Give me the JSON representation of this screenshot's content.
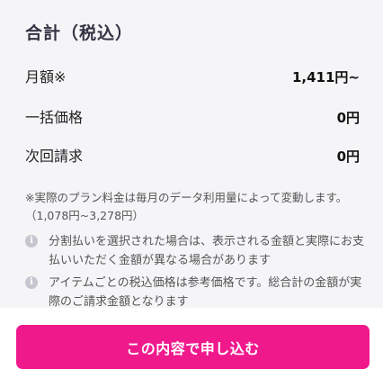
{
  "summary": {
    "title": "合計（税込）",
    "rows": [
      {
        "label": "月額※",
        "value": "1,411円~"
      },
      {
        "label": "一括価格",
        "value": "0円"
      },
      {
        "label": "次回請求",
        "value": "0円"
      }
    ]
  },
  "note": "※実際のプラン料金は毎月のデータ利用量によって変動します。（1,078円~3,278円）",
  "info_items": [
    {
      "icon": "info-icon",
      "text": "分割払いを選択された場合は、表示される金額と実際にお支払いいただく金額が異なる場合があります"
    },
    {
      "icon": "info-icon",
      "text": "アイテムごとの税込価格は参考価格です。総合計の金額が実際のご請求金額となります"
    }
  ],
  "cta": {
    "label": "この内容で申し込む"
  },
  "colors": {
    "accent": "#f0198c",
    "background": "#f5f5f8"
  }
}
